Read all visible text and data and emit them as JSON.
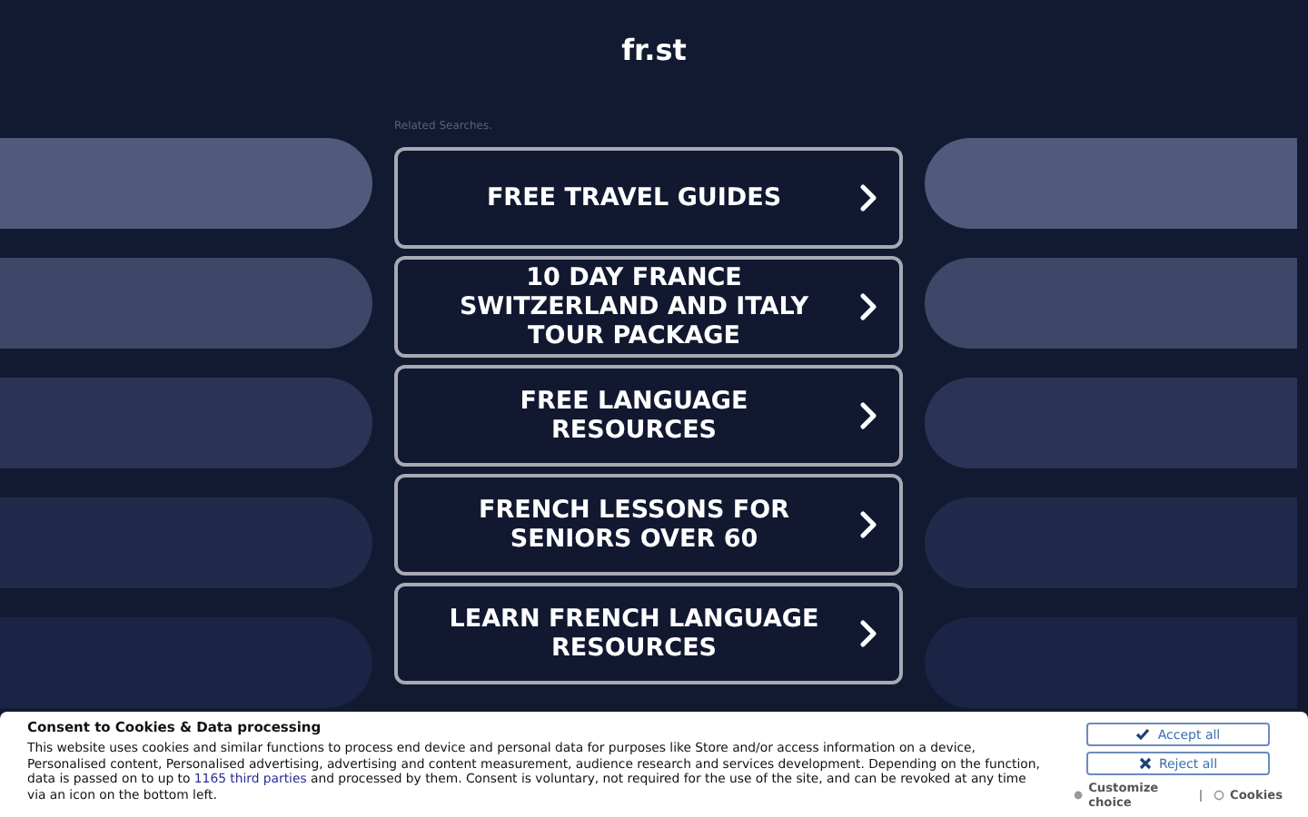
{
  "site": {
    "title": "fr.st"
  },
  "related": {
    "label": "Related Searches.",
    "links": [
      {
        "text": "FREE TRAVEL GUIDES"
      },
      {
        "text": "10 DAY FRANCE SWITZERLAND AND ITALY TOUR PACKAGE"
      },
      {
        "text": "FREE LANGUAGE RESOURCES"
      },
      {
        "text": "FRENCH LESSONS FOR SENIORS OVER 60"
      },
      {
        "text": "LEARN FRENCH LANGUAGE RESOURCES"
      }
    ]
  },
  "consent": {
    "title": "Consent to Cookies & Data processing",
    "text_before": "This website uses cookies and similar functions to process end device and personal data for purposes like Store and/or access information on a device, Personalised content, Personalised advertising, advertising and content measurement, audience research and services development. Depending on the function, data is passed on to up to ",
    "link": "1165 third parties",
    "text_after": " and processed by them. Consent is voluntary, not required for the use of the site, and can be revoked at any time via an icon on the bottom left.",
    "buttons": [
      {
        "kind": "accept",
        "label": "Accept all"
      },
      {
        "kind": "reject",
        "label": "Reject all"
      }
    ],
    "links": [
      {
        "label": "Customize choice"
      },
      {
        "label": "Cookies"
      }
    ],
    "separator": "|"
  }
}
